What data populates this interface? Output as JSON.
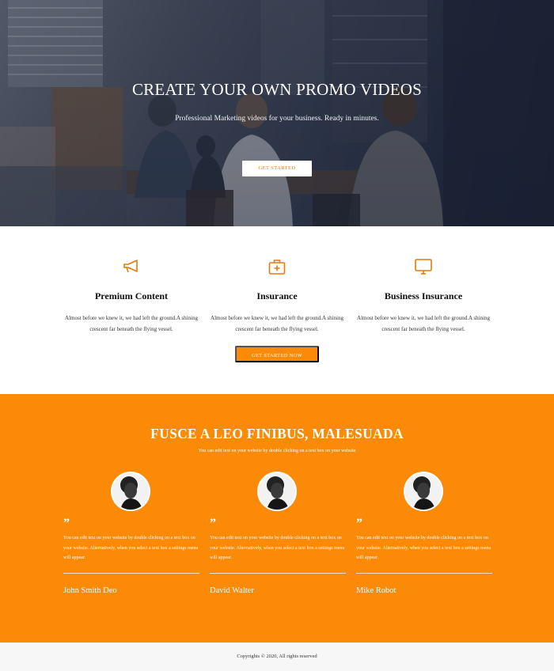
{
  "hero": {
    "title": "CREATE YOUR OWN PROMO VIDEOS",
    "subtitle": "Professional Marketing videos for your business. Ready in minutes.",
    "button_label": "GET STARTED"
  },
  "features": {
    "items": [
      {
        "icon": "megaphone-icon",
        "title": "Premium Content",
        "text": "Almost before we knew it, we had left the ground.A shining crescent far beneath the flying vessel."
      },
      {
        "icon": "first-aid-kit-icon",
        "title": "Insurance",
        "text": "Almost before we knew it, we had left the ground.A shining crescent far beneath the flying vessel."
      },
      {
        "icon": "monitor-icon",
        "title": "Business Insurance",
        "text": "Almost before we knew it, we had left the ground.A shining crescent far beneath the flying vessel."
      }
    ],
    "cta_label": "GET STARTED NOW",
    "accent_color": "#e37a0a"
  },
  "testimonials": {
    "title": "FUSCE A LEO FINIBUS, MALESUADA",
    "subtitle": "You can edit text on your website by double clicking on a text box on your website",
    "quote_glyph": "”",
    "items": [
      {
        "text": "You can edit text on your website by double clicking on a text box on your website. Alternatively, when you select a text box a settings menu will appear.",
        "name": "John Smith Deo"
      },
      {
        "text": "You can edit text on your website by double clicking on a text box on your website. Alternatively, when you select a text box a settings menu will appear.",
        "name": "David Walter"
      },
      {
        "text": "You can edit text on your website by double clicking on a text box on your website. Alternatively, when you select a text box a settings menu will appear.",
        "name": "Mike Robot"
      }
    ],
    "background_color": "#fb8a09"
  },
  "footer": {
    "copyright": "Copyrights © 2020, All rights reserved"
  }
}
